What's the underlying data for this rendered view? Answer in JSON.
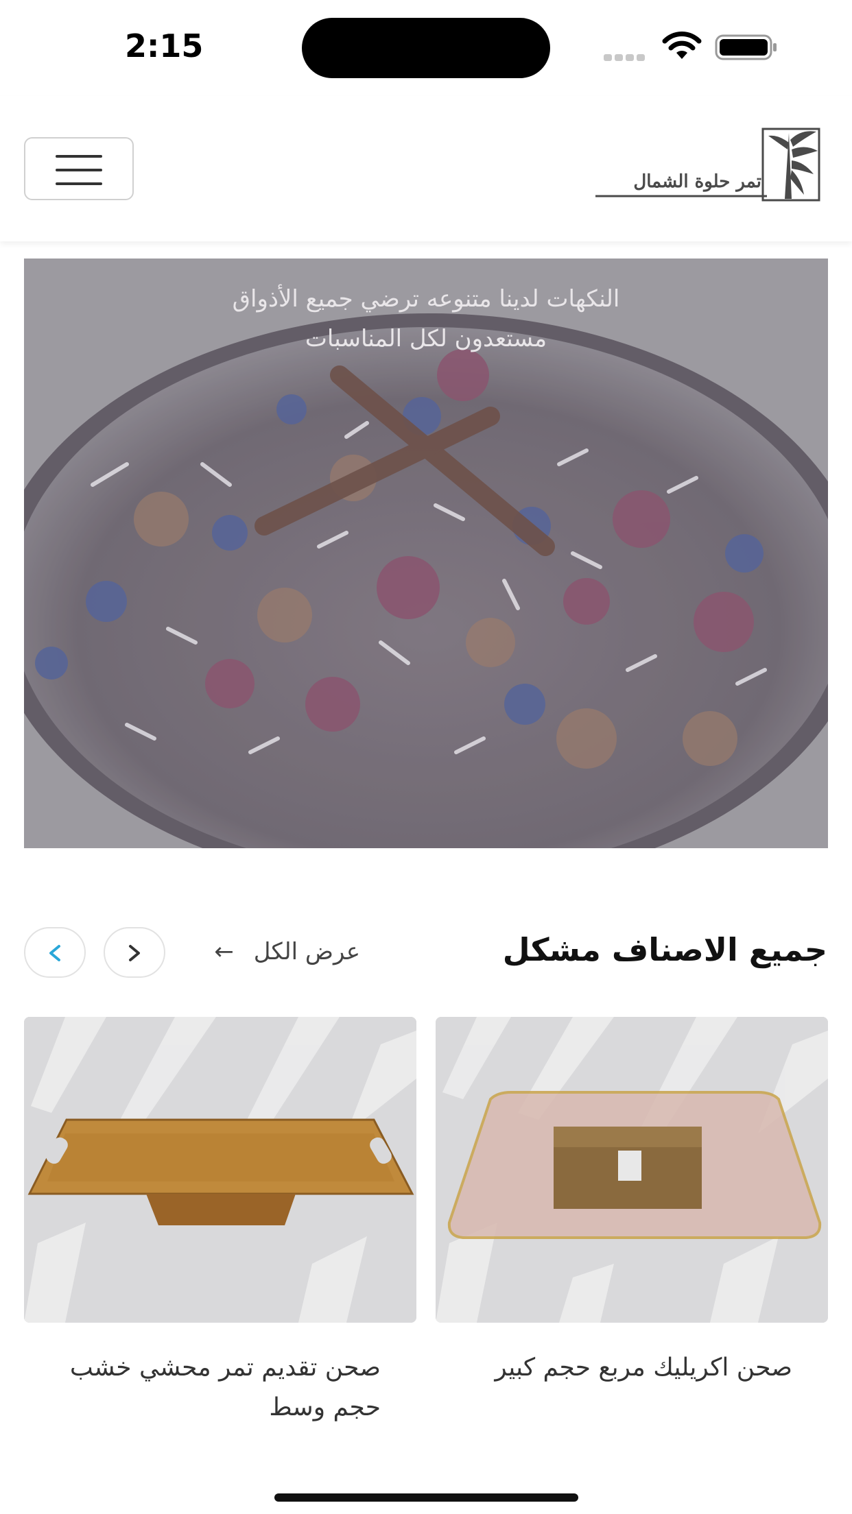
{
  "status_bar": {
    "time": "2:15",
    "wifi_icon": "wifi-icon",
    "battery_icon": "battery-icon"
  },
  "header": {
    "logo_text": "تمر حلوة الشمال",
    "logo_icon": "palm-tree-icon",
    "menu_icon": "hamburger-menu-icon"
  },
  "hero": {
    "caption_line1": "النكهات لدينا متنوعه ترضي جميع الأذواق",
    "caption_line2": "مستعدون لكل المناسبات"
  },
  "section": {
    "title": "جميع الاصناف مشكل",
    "view_all_label": "عرض الكل",
    "view_all_arrow": "←",
    "next_icon": "chevron-right-icon",
    "prev_icon": "chevron-left-icon"
  },
  "products": [
    {
      "title": "صحن اكريليك مربع حجم كبير"
    },
    {
      "title": "صحن تقديم تمر محشي خشب حجم وسط"
    }
  ],
  "colors": {
    "accent": "#2aa7d8",
    "text": "#222222",
    "hero_overlay": "#77727a"
  }
}
